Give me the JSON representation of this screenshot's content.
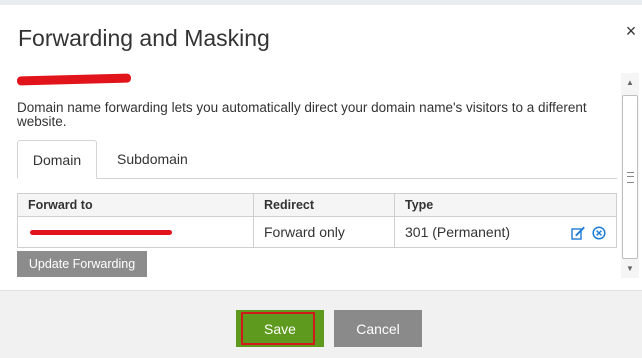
{
  "dialog": {
    "title": "Forwarding and Masking",
    "close_glyph": "×",
    "description": "Domain name forwarding lets you automatically direct your domain name's visitors to a different website."
  },
  "tabs": [
    {
      "label": "Domain",
      "active": true
    },
    {
      "label": "Subdomain",
      "active": false
    }
  ],
  "table": {
    "headers": [
      "Forward to",
      "Redirect",
      "Type"
    ],
    "rows": [
      {
        "forward_to": "",
        "redirect": "Forward only",
        "type": "301 (Permanent)"
      }
    ]
  },
  "buttons": {
    "update": "Update Forwarding",
    "save": "Save",
    "cancel": "Cancel"
  },
  "icons": {
    "close": "close-icon",
    "edit": "edit-icon",
    "delete": "delete-circle-icon",
    "scroll_up": "chevron-up-icon",
    "scroll_down": "chevron-down-icon"
  },
  "colors": {
    "save_green": "#5e9a1e",
    "highlight_red": "#d01a1a",
    "action_blue": "#1e7bd6",
    "button_gray": "#8a8a8a"
  }
}
